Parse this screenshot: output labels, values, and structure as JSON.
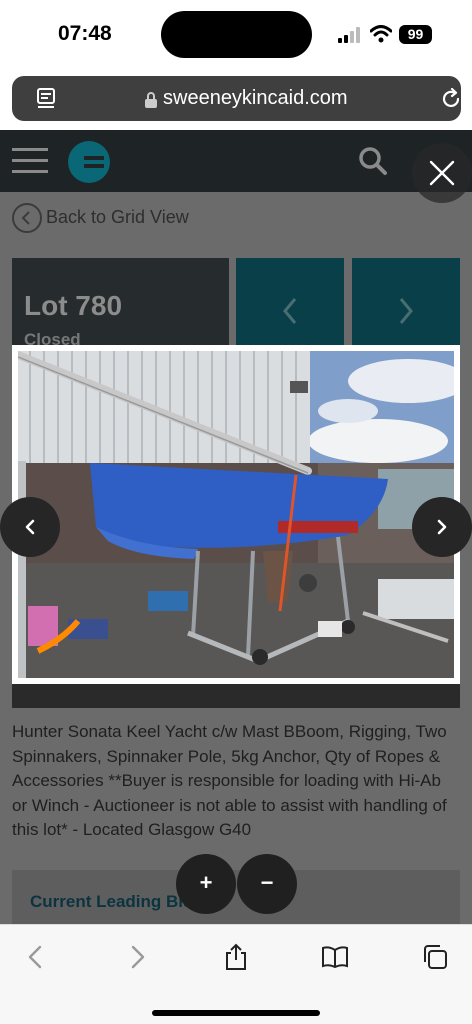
{
  "status_bar": {
    "time": "07:48",
    "battery": "99"
  },
  "browser": {
    "url": "sweeneykincaid.com"
  },
  "page": {
    "back_label": "Back to Grid View",
    "lot_title": "Lot 780",
    "lot_status": "Closed",
    "description": "Hunter Sonata Keel Yacht c/w Mast BBoom, Rigging, Two Spinnakers, Spinnaker Pole, 5kg Anchor, Qty of Ropes & Accessories **Buyer is responsible for loading with Hi-Ab or Winch - Auctioneer is not able to assist with handling of this lot* - Located Glasgow G40",
    "bid_label": "Current Leading Bid"
  },
  "lightbox": {
    "zoom_in_label": "+",
    "zoom_out_label": "−"
  },
  "colors": {
    "brand_teal": "#0a6776",
    "nav_box": "#093f48",
    "header": "#1e2326",
    "hull_blue": "#2f5fc4"
  },
  "icons": [
    "reader-icon",
    "lock-icon",
    "reload-icon",
    "hamburger-icon",
    "search-icon",
    "close-icon",
    "chevron-left-icon",
    "chevron-right-icon",
    "share-icon",
    "bookmarks-icon",
    "tabs-icon"
  ]
}
